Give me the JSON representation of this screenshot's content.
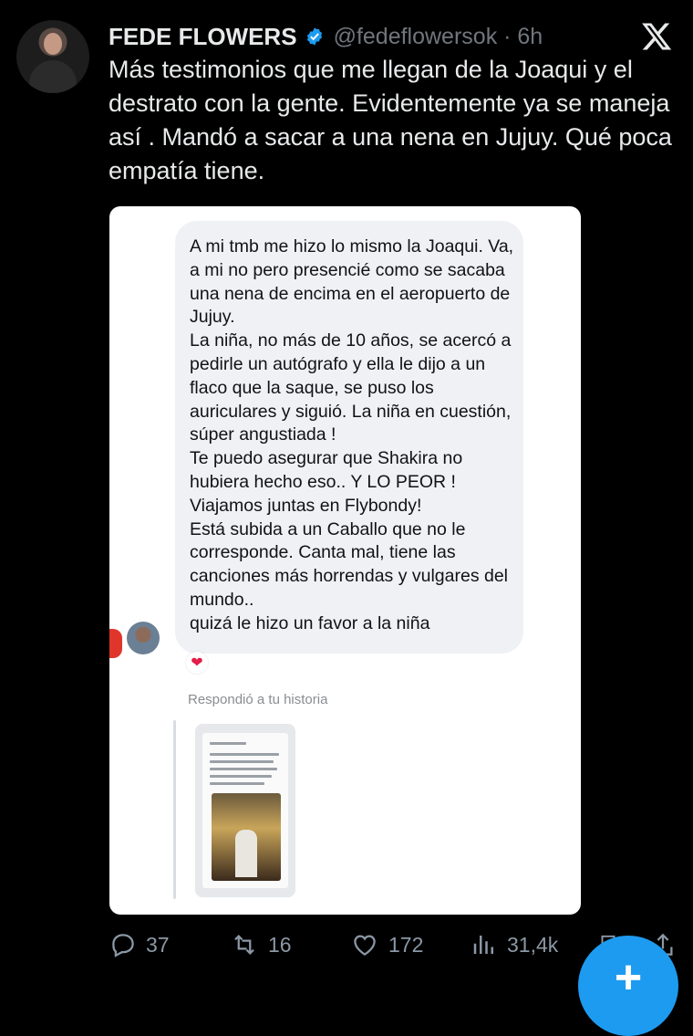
{
  "tweet": {
    "author_name": "FEDE FLOWERS",
    "handle_time": "@fedeflowersok · 6h",
    "text": "Más testimonios que me llegan de la Joaqui y el destrato con la gente. Evidentemente ya se maneja así . Mandó a sacar a una nena en Jujuy. Qué poca empatía tiene."
  },
  "screenshot_card": {
    "message_paragraphs": [
      "A mi tmb me hizo lo mismo la Joaqui. Va, a mi no pero presencié como se sacaba una nena de encima en el aeropuerto de Jujuy.",
      "La niña, no más de 10 años, se acercó a pedirle un autógrafo y ella le dijo a un flaco que la saque, se puso los auriculares y siguió. La niña en cuestión, súper angustiada !",
      "Te puedo asegurar que Shakira no hubiera hecho eso.. Y LO PEOR ! Viajamos juntas en Flybondy!",
      "Está subida a un Caballo que no le corresponde. Canta mal, tiene las canciones más horrendas y vulgares del mundo..",
      "quizá le hizo un favor a la niña"
    ],
    "reaction": "❤",
    "reply_label": "Respondió a tu historia"
  },
  "stats": {
    "replies": "37",
    "reposts": "16",
    "likes": "172",
    "views": "31,4k"
  },
  "fab_label": "+",
  "colors": {
    "background": "#000000",
    "text": "#e7e9ea",
    "muted": "#71767b",
    "verified": "#1d9bf0",
    "fab": "#1d9bf0"
  }
}
